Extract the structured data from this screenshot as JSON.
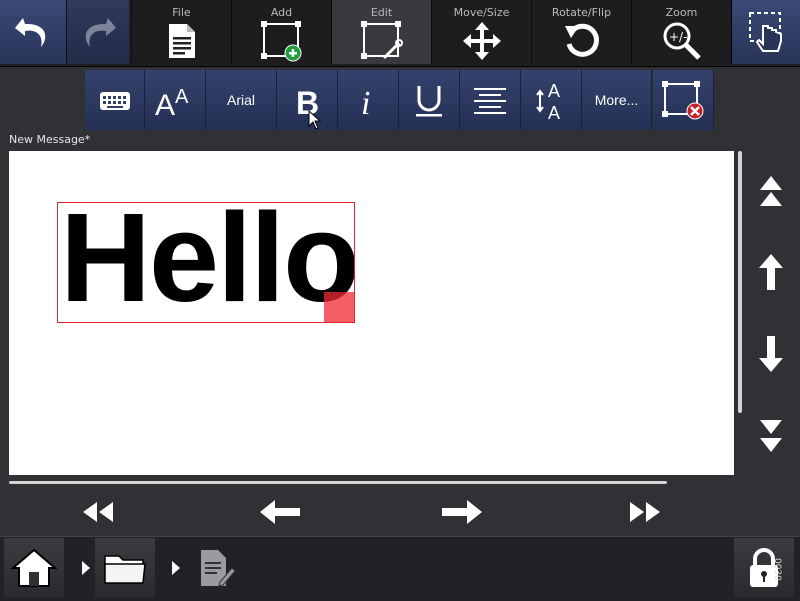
{
  "top_toolbar": {
    "menus": [
      {
        "label": "File",
        "icon": "document-icon"
      },
      {
        "label": "Add",
        "icon": "add-frame-icon"
      },
      {
        "label": "Edit",
        "icon": "edit-frame-icon"
      },
      {
        "label": "Move/Size",
        "icon": "move-arrows-icon"
      },
      {
        "label": "Rotate/Flip",
        "icon": "rotate-icon"
      },
      {
        "label": "Zoom",
        "icon": "zoom-icon"
      }
    ],
    "active_menu": "Edit"
  },
  "format_bar": {
    "font_name": "Arial",
    "more_label": "More..."
  },
  "document": {
    "title": "New Message*",
    "text_content": "Hello"
  },
  "status": {
    "version": "0030"
  },
  "colors": {
    "toolbar_blue": "#2e3b63",
    "selection_red": "#e4262c",
    "add_green": "#1e9e3a"
  }
}
